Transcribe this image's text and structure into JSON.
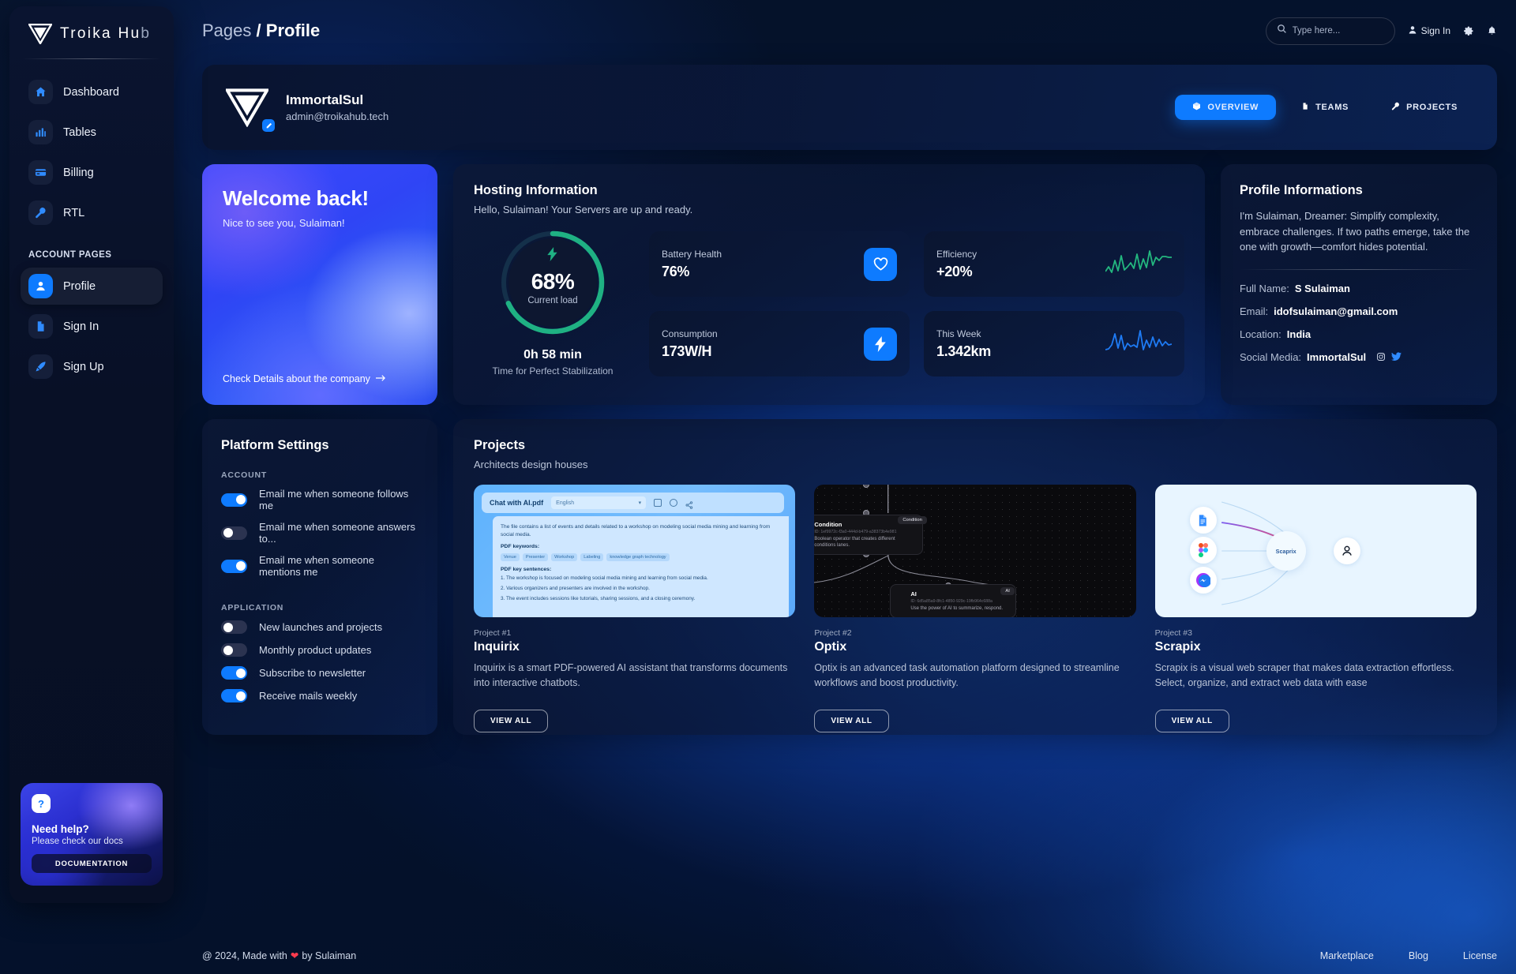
{
  "brand": {
    "name_main": "Troika Hu",
    "name_dim": "b"
  },
  "sidebar": {
    "items": [
      {
        "label": "Dashboard",
        "icon": "home-icon"
      },
      {
        "label": "Tables",
        "icon": "chart-bar-icon"
      },
      {
        "label": "Billing",
        "icon": "credit-card-icon"
      },
      {
        "label": "RTL",
        "icon": "wrench-icon"
      }
    ],
    "section_label": "ACCOUNT PAGES",
    "account_items": [
      {
        "label": "Profile",
        "icon": "user-icon",
        "active": true
      },
      {
        "label": "Sign In",
        "icon": "document-icon",
        "active": false
      },
      {
        "label": "Sign Up",
        "icon": "rocket-icon",
        "active": false
      }
    ],
    "help": {
      "icon": "question-mark-icon",
      "title": "Need help?",
      "subtitle": "Please check our docs",
      "button": "DOCUMENTATION"
    }
  },
  "topbar": {
    "breadcrumb_parent": "Pages",
    "breadcrumb_sep": "/",
    "breadcrumb_current": "Profile",
    "search_placeholder": "Type here...",
    "search_value": "",
    "signin_label": "Sign In",
    "icons": [
      "search-icon",
      "person-icon",
      "gear-icon",
      "bell-icon"
    ]
  },
  "profile_header": {
    "name": "ImmortalSul",
    "email": "admin@troikahub.tech",
    "tabs": [
      {
        "label": "OVERVIEW",
        "icon": "cube-icon",
        "active": true
      },
      {
        "label": "TEAMS",
        "icon": "document-icon",
        "active": false
      },
      {
        "label": "PROJECTS",
        "icon": "wrench-icon",
        "active": false
      }
    ]
  },
  "welcome": {
    "title": "Welcome back!",
    "subtitle": "Nice to see you, Sulaiman!",
    "link": "Check Details about the company",
    "link_icon": "arrow-right-icon"
  },
  "hosting": {
    "title": "Hosting Information",
    "subtitle": "Hello, Sulaiman! Your Servers are up and ready.",
    "gauge_value": "68%",
    "gauge_percent": 68,
    "gauge_label": "Current load",
    "gauge_color": "#1fb183",
    "stabilization_time": "0h 58 min",
    "stabilization_label": "Time for Perfect Stabilization",
    "tiles": [
      {
        "label": "Battery Health",
        "value": "76%",
        "icon": "heart-icon",
        "kind": "square"
      },
      {
        "label": "Efficiency",
        "value": "+20%",
        "icon": "sparkline-green",
        "kind": "spark",
        "spark_color": "#23b77f"
      },
      {
        "label": "Consumption",
        "value": "173W/H",
        "icon": "bolt-icon",
        "kind": "square"
      },
      {
        "label": "This Week",
        "value": "1.342km",
        "icon": "sparkline-blue",
        "kind": "spark",
        "spark_color": "#1e7bf5"
      }
    ]
  },
  "profile_info": {
    "title": "Profile Informations",
    "bio": "I'm Sulaiman, Dreamer: Simplify complexity, embrace challenges. If two paths emerge, take the one with growth—comfort hides potential.",
    "fields": [
      {
        "label": "Full Name:",
        "value": "S Sulaiman"
      },
      {
        "label": "Email:",
        "value": "idofsulaiman@gmail.com"
      },
      {
        "label": "Location:",
        "value": "India"
      },
      {
        "label": "Social Media:",
        "value": "ImmortalSul"
      }
    ],
    "social_icons": [
      "instagram-icon",
      "twitter-icon"
    ]
  },
  "settings": {
    "title": "Platform Settings",
    "group_account": "ACCOUNT",
    "group_application": "APPLICATION",
    "account_items": [
      {
        "label": "Email me when someone follows me",
        "on": true
      },
      {
        "label": "Email me when someone answers to...",
        "on": false
      },
      {
        "label": "Email me when someone mentions me",
        "on": true
      }
    ],
    "application_items": [
      {
        "label": "New launches and projects",
        "on": false
      },
      {
        "label": "Monthly product updates",
        "on": false
      },
      {
        "label": "Subscribe to newsletter",
        "on": true
      },
      {
        "label": "Receive mails weekly",
        "on": true
      }
    ]
  },
  "projects": {
    "title": "Projects",
    "subtitle": "Architects design houses",
    "items": [
      {
        "number": "Project #1",
        "title": "Inquirix",
        "desc": "Inquirix is a smart PDF-powered AI assistant that transforms documents into interactive chatbots.",
        "button": "VIEW ALL",
        "thumb": {
          "kind": "pdf-chat",
          "file_name": "Chat with AI.pdf",
          "language": "English",
          "body": "The file contains a list of events and details related to a workshop on modeling social media mining and learning from social media.",
          "keywords_label": "PDF keywords:",
          "keywords": [
            "Venue",
            "Presenter",
            "Workshop",
            "Labeling",
            "knowledge graph technology"
          ],
          "sentences_label": "PDF key sentences:",
          "sentences": [
            "1. The workshop is focused on modeling social media mining and learning from social media.",
            "2. Various organizers and presenters are involved in the workshop.",
            "3. The event includes sessions like tutorials, sharing sessions, and a closing ceremony."
          ]
        }
      },
      {
        "number": "Project #2",
        "title": "Optix",
        "desc": "Optix is an advanced task automation platform designed to streamline workflows and boost productivity.",
        "button": "VIEW ALL",
        "thumb": {
          "kind": "flow-canvas",
          "nodes": [
            {
              "title": "Condition",
              "id": "ID: 1ef9972c-f3a0-444d-b479-a38373b4e981",
              "desc": "Boolean operator that creates different conditions lanes.",
              "pill": "Condition"
            },
            {
              "title": "AI",
              "id": "ID: 6d5a85a9-8fc1-4850-929c-19fb964c688a",
              "desc": "Use the power of AI to summarize, respond.",
              "pill": "AI"
            }
          ]
        }
      },
      {
        "number": "Project #3",
        "title": "Scrapix",
        "desc": "Scrapix is a visual web scraper that makes data extraction  effortless. Select, organize, and extract web data with ease",
        "button": "VIEW ALL",
        "thumb": {
          "kind": "node-graph",
          "hub_label": "Scaprix",
          "nodes": [
            "document-icon",
            "figma-icon",
            "messenger-icon",
            "person-icon"
          ]
        }
      }
    ]
  },
  "footer": {
    "copyright_pre": "@ 2024, Made with",
    "heart": "heart-icon",
    "copyright_post": "by Sulaiman",
    "links": [
      "Marketplace",
      "Blog",
      "License"
    ]
  }
}
